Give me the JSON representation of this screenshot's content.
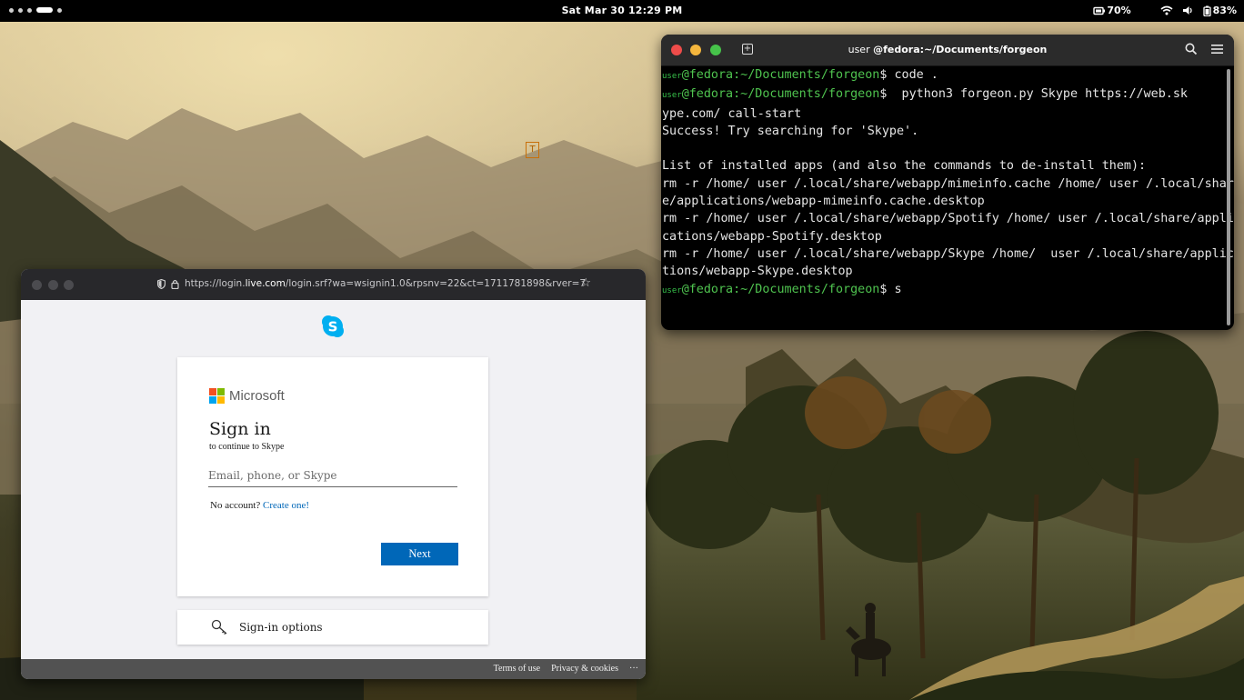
{
  "topbar": {
    "clock": "Sat Mar 30  12:29 PM",
    "battery_secondary": "70%",
    "battery_main": "83%",
    "icons": [
      "wifi-icon",
      "volume-icon",
      "battery-icon"
    ]
  },
  "terminal": {
    "title_prefix": "user",
    "title_path": "@fedora:~/Documents/forgeon",
    "lines": [
      {
        "user": "user",
        "host": "@fedora:~/Documents/forgeon",
        "cmd": "$ code ."
      },
      {
        "user": "user",
        "host": "@fedora:~/Documents/forgeon",
        "cmd": "$  python3 forgeon.py Skype https://web.sk"
      },
      {
        "text": "ype.com/ call-start"
      },
      {
        "text": "Success! Try searching for 'Skype'."
      },
      {
        "text": ""
      },
      {
        "text": "List of installed apps (and also the commands to de-install them):"
      },
      {
        "text": "rm -r /home/ user /.local/share/webapp/mimeinfo.cache /home/ user /.local/shar"
      },
      {
        "text": "e/applications/webapp-mimeinfo.cache.desktop"
      },
      {
        "text": "rm -r /home/ user /.local/share/webapp/Spotify /home/ user /.local/share/appli"
      },
      {
        "text": "cations/webapp-Spotify.desktop"
      },
      {
        "text": "rm -r /home/ user /.local/share/webapp/Skype /home/  user /.local/share/applica"
      },
      {
        "text": "tions/webapp-Skype.desktop"
      },
      {
        "user": "user",
        "host": "@fedora:~/Documents/forgeon",
        "cmd": "$ s"
      }
    ]
  },
  "browser": {
    "url_plain_prefix": "https://login.",
    "url_host": "live.com",
    "url_rest": "/login.srf?wa=wsignin1.0&rpsnv=22&ct=1711781898&rver=7",
    "microsoft_label": "Microsoft",
    "signin_title": "Sign in",
    "signin_subtitle": "to continue to Skype",
    "email_placeholder": "Email, phone, or Skype",
    "no_account_text": "No account?",
    "create_link": "Create one!",
    "next_button": "Next",
    "signin_options": "Sign-in options",
    "footer": {
      "terms": "Terms of use",
      "privacy": "Privacy & cookies",
      "more": "···"
    }
  },
  "colors": {
    "ms_blue": "#0067b8",
    "prompt_green": "#4fc34f",
    "skype_blue": "#00aff0"
  }
}
